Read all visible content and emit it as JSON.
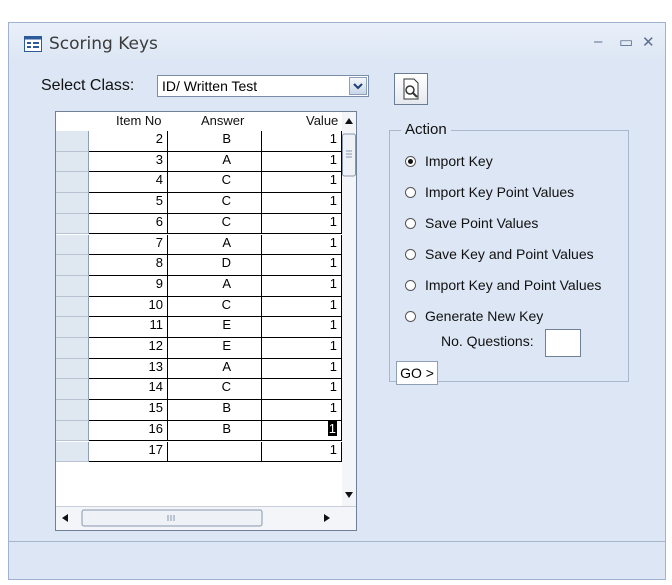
{
  "window": {
    "title": "Scoring Keys",
    "minimize": "–",
    "maximize": "▭",
    "close": "✕"
  },
  "select": {
    "label": "Select Class:",
    "value": "ID/ Written Test"
  },
  "grid": {
    "columns": [
      "Item No",
      "Answer",
      "Value"
    ],
    "rows": [
      {
        "item": "2",
        "answer": "B",
        "value": "1"
      },
      {
        "item": "3",
        "answer": "A",
        "value": "1"
      },
      {
        "item": "4",
        "answer": "C",
        "value": "1"
      },
      {
        "item": "5",
        "answer": "C",
        "value": "1"
      },
      {
        "item": "6",
        "answer": "C",
        "value": "1"
      },
      {
        "item": "7",
        "answer": "A",
        "value": "1"
      },
      {
        "item": "8",
        "answer": "D",
        "value": "1"
      },
      {
        "item": "9",
        "answer": "A",
        "value": "1"
      },
      {
        "item": "10",
        "answer": "C",
        "value": "1"
      },
      {
        "item": "11",
        "answer": "E",
        "value": "1"
      },
      {
        "item": "12",
        "answer": "E",
        "value": "1"
      },
      {
        "item": "13",
        "answer": "A",
        "value": "1"
      },
      {
        "item": "14",
        "answer": "C",
        "value": "1"
      },
      {
        "item": "15",
        "answer": "B",
        "value": "1"
      },
      {
        "item": "16",
        "answer": "B",
        "value": "1"
      },
      {
        "item": "17",
        "answer": "",
        "value": "1"
      }
    ],
    "active_row": 14
  },
  "action": {
    "label": "Action",
    "options": [
      {
        "label": "Import Key",
        "selected": true
      },
      {
        "label": "Import Key Point Values",
        "selected": false
      },
      {
        "label": "Save Point Values",
        "selected": false
      },
      {
        "label": "Save Key and Point Values",
        "selected": false
      },
      {
        "label": "Import Key and Point Values",
        "selected": false
      },
      {
        "label": "Generate New Key",
        "selected": false
      }
    ],
    "questions_label": "No. Questions:",
    "questions_value": "",
    "go_label": "GO >"
  }
}
